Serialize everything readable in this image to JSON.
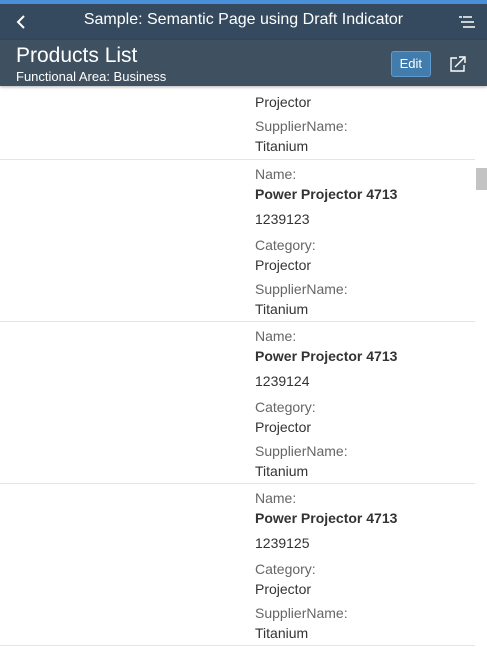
{
  "shell": {
    "title": "Sample: Semantic Page using Draft Indicator",
    "back_icon": "chevron-left-icon",
    "menu_icon": "menu-icon"
  },
  "header": {
    "title": "Products List",
    "subtitle": "Functional Area: Business",
    "edit_label": "Edit",
    "share_icon": "share-icon"
  },
  "labels": {
    "name": "Name:",
    "category": "Category:",
    "supplier": "SupplierName:"
  },
  "partial_item": {
    "category": "Projector",
    "supplier": "Titanium"
  },
  "items": [
    {
      "name": "Power Projector 4713",
      "id": "1239123",
      "category": "Projector",
      "supplier": "Titanium"
    },
    {
      "name": "Power Projector 4713",
      "id": "1239124",
      "category": "Projector",
      "supplier": "Titanium"
    },
    {
      "name": "Power Projector 4713",
      "id": "1239125",
      "category": "Projector",
      "supplier": "Titanium"
    }
  ],
  "colors": {
    "shell": "#354a5f",
    "header": "#3f5161",
    "accent": "#427cac"
  }
}
